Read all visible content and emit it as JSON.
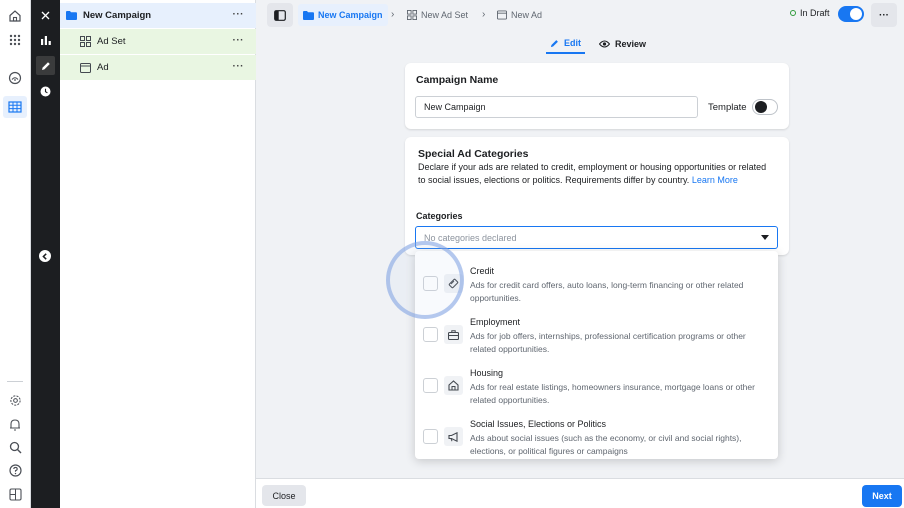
{
  "tree": {
    "campaign": "New Campaign",
    "adset": "Ad Set",
    "ad": "Ad",
    "more": "···"
  },
  "topbar": {
    "breadcrumb": [
      "New Campaign",
      "New Ad Set",
      "New Ad"
    ],
    "status": "In Draft",
    "more": "···"
  },
  "tabs": {
    "edit": "Edit",
    "review": "Review"
  },
  "campaign_name": {
    "heading": "Campaign Name",
    "value": "New Campaign",
    "template_label": "Template"
  },
  "special_ad_categories": {
    "heading": "Special Ad Categories",
    "description": "Declare if your ads are related to credit, employment or housing opportunities or related to social issues, elections or politics. Requirements differ by country.",
    "learn_more": "Learn More",
    "categories_label": "Categories",
    "placeholder": "No categories declared"
  },
  "options": [
    {
      "title": "Credit",
      "desc": "Ads for credit card offers, auto loans, long-term financing or other related opportunities.",
      "icon": "credit-card-icon"
    },
    {
      "title": "Employment",
      "desc": "Ads for job offers, internships, professional certification programs or other related opportunities.",
      "icon": "briefcase-icon"
    },
    {
      "title": "Housing",
      "desc": "Ads for real estate listings, homeowners insurance, mortgage loans or other related opportunities.",
      "icon": "house-icon"
    },
    {
      "title": "Social Issues, Elections or Politics",
      "desc": "Ads about social issues (such as the economy, or civil and social rights), elections, or political figures or campaigns",
      "icon": "megaphone-icon"
    }
  ],
  "footer": {
    "close": "Close",
    "next": "Next"
  },
  "colors": {
    "accent": "#1877f2",
    "tree_selected": "#e7f0fd",
    "tree_child": "#e9f6e2",
    "dark_rail": "#1c1e21"
  }
}
